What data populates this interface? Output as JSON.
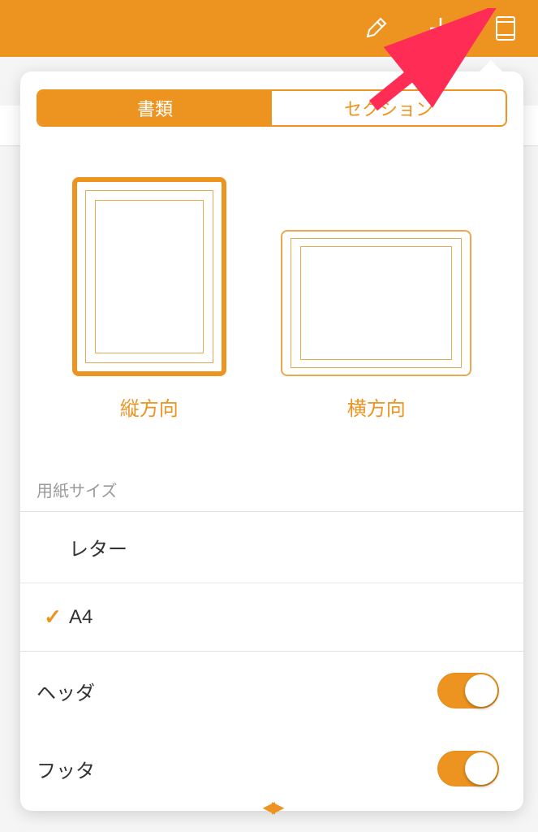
{
  "toolbar": {
    "icons": [
      "brush-icon",
      "plus-icon",
      "document-icon"
    ]
  },
  "popover": {
    "tabs": {
      "document": "書類",
      "section": "セクション"
    },
    "orientation": {
      "portrait": "縦方向",
      "landscape": "横方向",
      "selected": "portrait"
    },
    "paper_size": {
      "title": "用紙サイズ",
      "options": [
        {
          "label": "レター",
          "selected": false
        },
        {
          "label": "A4",
          "selected": true
        }
      ]
    },
    "toggles": {
      "header": {
        "label": "ヘッダ",
        "on": true
      },
      "footer": {
        "label": "フッタ",
        "on": true
      }
    }
  },
  "colors": {
    "accent": "#ed9420"
  }
}
